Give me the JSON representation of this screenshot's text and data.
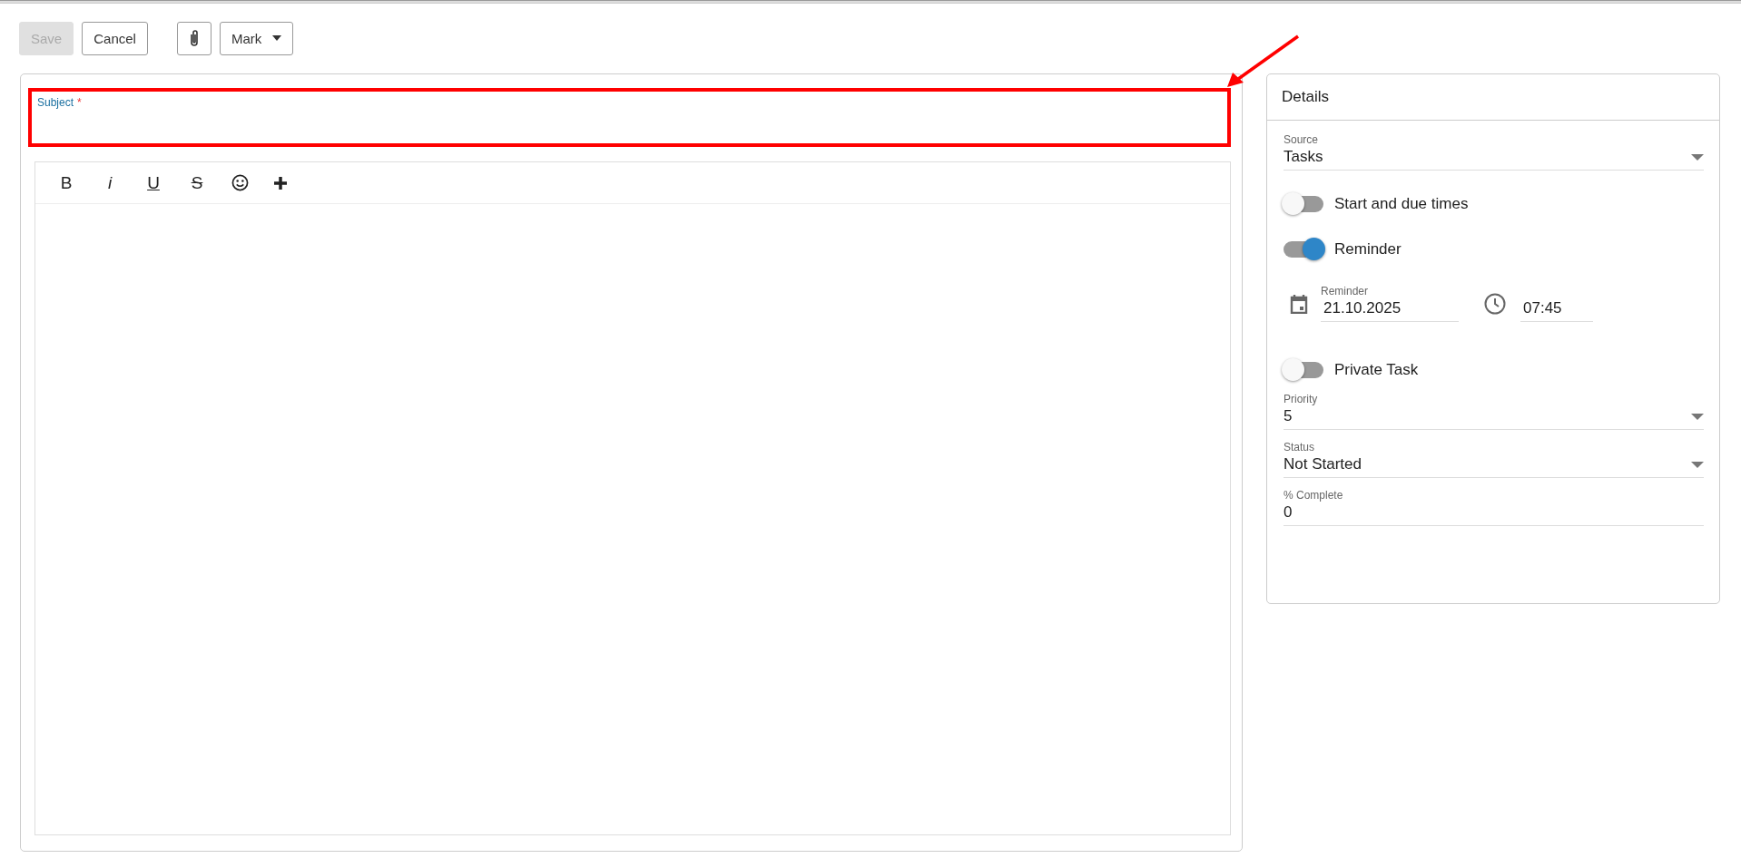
{
  "toolbar": {
    "buttons": [
      {
        "label": "Save",
        "kind": "text",
        "disabled": true
      },
      {
        "label": "Cancel",
        "kind": "text",
        "disabled": false
      },
      {
        "kind": "attach",
        "disabled": false
      },
      {
        "label": "Mark",
        "kind": "dropdown",
        "disabled": false
      }
    ]
  },
  "subject": {
    "label": "Subject",
    "required_mark": "*",
    "highlighted": true
  },
  "editor_toolbar": [
    {
      "kind": "bold",
      "label": "B"
    },
    {
      "kind": "italic",
      "label": "i"
    },
    {
      "kind": "underline",
      "label": "U"
    },
    {
      "kind": "strike",
      "label": "S"
    },
    {
      "kind": "emoji"
    },
    {
      "kind": "insert"
    }
  ],
  "details": {
    "title": "Details",
    "items": [
      {
        "kind": "select",
        "label": "Source",
        "value": "Tasks"
      },
      {
        "kind": "toggle",
        "label": "Start and due times",
        "on": false
      },
      {
        "kind": "toggle",
        "label": "Reminder",
        "on": true
      },
      {
        "kind": "datetime",
        "label": "Reminder",
        "date": "21.10.2025",
        "time": "07:45"
      },
      {
        "kind": "toggle",
        "label": "Private Task",
        "on": false
      },
      {
        "kind": "select",
        "label": "Priority",
        "value": "5"
      },
      {
        "kind": "select",
        "label": "Status",
        "value": "Not Started"
      },
      {
        "kind": "input",
        "label": "% Complete",
        "value": "0"
      }
    ]
  }
}
